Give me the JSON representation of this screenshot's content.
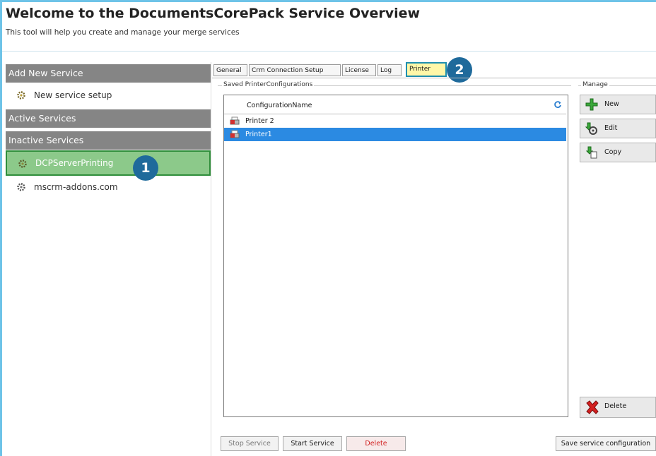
{
  "header": {
    "title": "Welcome to the DocumentsCorePack Service Overview",
    "subtitle": "This tool will help you create and manage your merge services"
  },
  "sidebar": {
    "add_new_header": "Add New Service",
    "new_service": "New service setup",
    "active_header": "Active Services",
    "inactive_header": "Inactive Services",
    "inactive_items": [
      "DCPServerPrinting",
      "mscrm-addons.com"
    ]
  },
  "callouts": {
    "one": "1",
    "two": "2"
  },
  "tabs": [
    "General",
    "Crm Connection Setup",
    "License",
    "Log",
    "Printer"
  ],
  "printer_panel": {
    "group_label": "Saved PrinterConfigurations",
    "column_header": "ConfigurationName",
    "rows": [
      "Printer 2",
      "Printer1"
    ],
    "selected_row": "Printer1"
  },
  "manage": {
    "label": "Manage",
    "new": "New",
    "edit": "Edit",
    "copy": "Copy",
    "delete": "Delete"
  },
  "footer": {
    "stop": "Stop Service",
    "start": "Start Service",
    "delete": "Delete",
    "save": "Save service configuration"
  },
  "colors": {
    "section_header": "#858585",
    "selected_service": "#8cc98a",
    "callout": "#1f6a9b",
    "active_tab": "#fff7a8",
    "selected_row": "#2b8ae2",
    "delete_text": "#d11f1f"
  }
}
